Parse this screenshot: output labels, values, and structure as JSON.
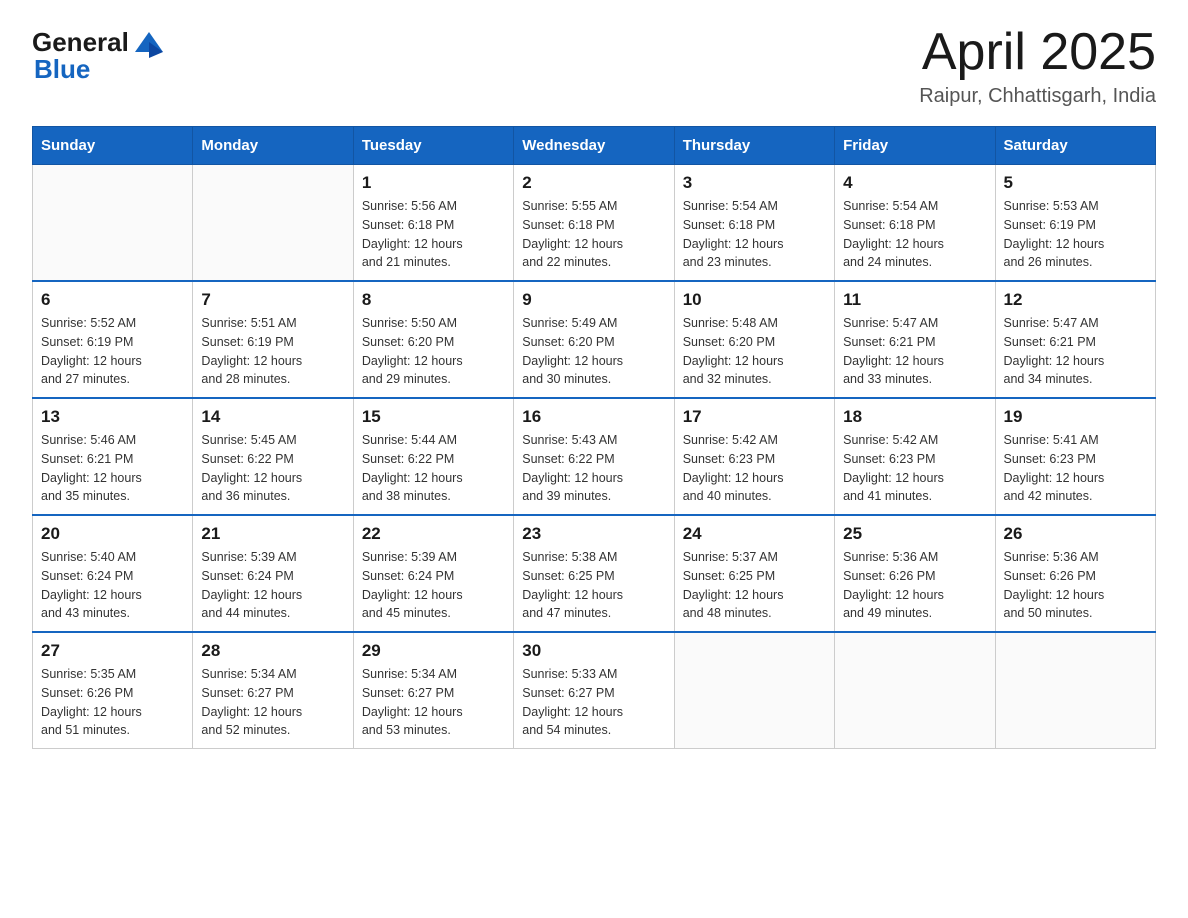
{
  "header": {
    "logo": {
      "text_general": "General",
      "text_blue": "Blue"
    },
    "title": "April 2025",
    "location": "Raipur, Chhattisgarh, India"
  },
  "calendar": {
    "days_of_week": [
      "Sunday",
      "Monday",
      "Tuesday",
      "Wednesday",
      "Thursday",
      "Friday",
      "Saturday"
    ],
    "weeks": [
      [
        {
          "day": "",
          "info": ""
        },
        {
          "day": "",
          "info": ""
        },
        {
          "day": "1",
          "info": "Sunrise: 5:56 AM\nSunset: 6:18 PM\nDaylight: 12 hours\nand 21 minutes."
        },
        {
          "day": "2",
          "info": "Sunrise: 5:55 AM\nSunset: 6:18 PM\nDaylight: 12 hours\nand 22 minutes."
        },
        {
          "day": "3",
          "info": "Sunrise: 5:54 AM\nSunset: 6:18 PM\nDaylight: 12 hours\nand 23 minutes."
        },
        {
          "day": "4",
          "info": "Sunrise: 5:54 AM\nSunset: 6:18 PM\nDaylight: 12 hours\nand 24 minutes."
        },
        {
          "day": "5",
          "info": "Sunrise: 5:53 AM\nSunset: 6:19 PM\nDaylight: 12 hours\nand 26 minutes."
        }
      ],
      [
        {
          "day": "6",
          "info": "Sunrise: 5:52 AM\nSunset: 6:19 PM\nDaylight: 12 hours\nand 27 minutes."
        },
        {
          "day": "7",
          "info": "Sunrise: 5:51 AM\nSunset: 6:19 PM\nDaylight: 12 hours\nand 28 minutes."
        },
        {
          "day": "8",
          "info": "Sunrise: 5:50 AM\nSunset: 6:20 PM\nDaylight: 12 hours\nand 29 minutes."
        },
        {
          "day": "9",
          "info": "Sunrise: 5:49 AM\nSunset: 6:20 PM\nDaylight: 12 hours\nand 30 minutes."
        },
        {
          "day": "10",
          "info": "Sunrise: 5:48 AM\nSunset: 6:20 PM\nDaylight: 12 hours\nand 32 minutes."
        },
        {
          "day": "11",
          "info": "Sunrise: 5:47 AM\nSunset: 6:21 PM\nDaylight: 12 hours\nand 33 minutes."
        },
        {
          "day": "12",
          "info": "Sunrise: 5:47 AM\nSunset: 6:21 PM\nDaylight: 12 hours\nand 34 minutes."
        }
      ],
      [
        {
          "day": "13",
          "info": "Sunrise: 5:46 AM\nSunset: 6:21 PM\nDaylight: 12 hours\nand 35 minutes."
        },
        {
          "day": "14",
          "info": "Sunrise: 5:45 AM\nSunset: 6:22 PM\nDaylight: 12 hours\nand 36 minutes."
        },
        {
          "day": "15",
          "info": "Sunrise: 5:44 AM\nSunset: 6:22 PM\nDaylight: 12 hours\nand 38 minutes."
        },
        {
          "day": "16",
          "info": "Sunrise: 5:43 AM\nSunset: 6:22 PM\nDaylight: 12 hours\nand 39 minutes."
        },
        {
          "day": "17",
          "info": "Sunrise: 5:42 AM\nSunset: 6:23 PM\nDaylight: 12 hours\nand 40 minutes."
        },
        {
          "day": "18",
          "info": "Sunrise: 5:42 AM\nSunset: 6:23 PM\nDaylight: 12 hours\nand 41 minutes."
        },
        {
          "day": "19",
          "info": "Sunrise: 5:41 AM\nSunset: 6:23 PM\nDaylight: 12 hours\nand 42 minutes."
        }
      ],
      [
        {
          "day": "20",
          "info": "Sunrise: 5:40 AM\nSunset: 6:24 PM\nDaylight: 12 hours\nand 43 minutes."
        },
        {
          "day": "21",
          "info": "Sunrise: 5:39 AM\nSunset: 6:24 PM\nDaylight: 12 hours\nand 44 minutes."
        },
        {
          "day": "22",
          "info": "Sunrise: 5:39 AM\nSunset: 6:24 PM\nDaylight: 12 hours\nand 45 minutes."
        },
        {
          "day": "23",
          "info": "Sunrise: 5:38 AM\nSunset: 6:25 PM\nDaylight: 12 hours\nand 47 minutes."
        },
        {
          "day": "24",
          "info": "Sunrise: 5:37 AM\nSunset: 6:25 PM\nDaylight: 12 hours\nand 48 minutes."
        },
        {
          "day": "25",
          "info": "Sunrise: 5:36 AM\nSunset: 6:26 PM\nDaylight: 12 hours\nand 49 minutes."
        },
        {
          "day": "26",
          "info": "Sunrise: 5:36 AM\nSunset: 6:26 PM\nDaylight: 12 hours\nand 50 minutes."
        }
      ],
      [
        {
          "day": "27",
          "info": "Sunrise: 5:35 AM\nSunset: 6:26 PM\nDaylight: 12 hours\nand 51 minutes."
        },
        {
          "day": "28",
          "info": "Sunrise: 5:34 AM\nSunset: 6:27 PM\nDaylight: 12 hours\nand 52 minutes."
        },
        {
          "day": "29",
          "info": "Sunrise: 5:34 AM\nSunset: 6:27 PM\nDaylight: 12 hours\nand 53 minutes."
        },
        {
          "day": "30",
          "info": "Sunrise: 5:33 AM\nSunset: 6:27 PM\nDaylight: 12 hours\nand 54 minutes."
        },
        {
          "day": "",
          "info": ""
        },
        {
          "day": "",
          "info": ""
        },
        {
          "day": "",
          "info": ""
        }
      ]
    ]
  }
}
